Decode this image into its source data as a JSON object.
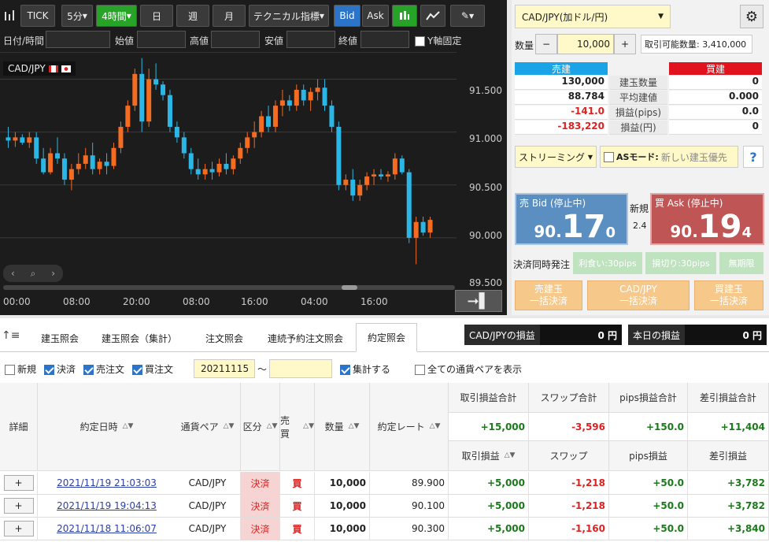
{
  "toolbar": {
    "tick": "TICK",
    "m5": "5分",
    "h4": "4時間",
    "day": "日",
    "week": "週",
    "month": "月",
    "tech": "テクニカル指標",
    "bid": "Bid",
    "ask": "Ask"
  },
  "header": {
    "date": "日付/時間",
    "open": "始値",
    "high": "高値",
    "low": "安値",
    "close": "終値",
    "yfix": "Y軸固定"
  },
  "symbol": "CAD/JPY",
  "prices": [
    "91.500",
    "91.000",
    "90.500",
    "90.000",
    "89.500"
  ],
  "times": [
    "00:00",
    "08:00",
    "20:00",
    "08:00",
    "16:00",
    "04:00",
    "16:00"
  ],
  "chart_data": {
    "type": "candlestick",
    "ylim": [
      89.5,
      91.75
    ],
    "candles": [
      [
        90.95,
        91.05,
        90.85,
        90.92
      ],
      [
        90.92,
        91.0,
        90.86,
        90.95
      ],
      [
        90.95,
        90.98,
        90.88,
        90.9
      ],
      [
        90.9,
        91.0,
        90.85,
        90.95
      ],
      [
        90.95,
        91.0,
        90.7,
        90.75
      ],
      [
        90.75,
        90.85,
        90.6,
        90.62
      ],
      [
        90.62,
        90.85,
        90.6,
        90.8
      ],
      [
        90.8,
        90.95,
        90.7,
        90.75
      ],
      [
        90.75,
        90.8,
        90.5,
        90.55
      ],
      [
        90.55,
        90.7,
        90.45,
        90.65
      ],
      [
        90.65,
        90.8,
        90.6,
        90.7
      ],
      [
        90.7,
        90.85,
        90.65,
        90.78
      ],
      [
        90.78,
        90.9,
        90.6,
        90.65
      ],
      [
        90.65,
        90.75,
        90.6,
        90.72
      ],
      [
        90.72,
        90.8,
        90.6,
        90.68
      ],
      [
        90.68,
        90.9,
        90.65,
        90.85
      ],
      [
        90.85,
        91.1,
        90.8,
        91.05
      ],
      [
        91.05,
        91.3,
        91.0,
        91.25
      ],
      [
        91.25,
        91.6,
        91.2,
        91.55
      ],
      [
        91.55,
        91.7,
        91.0,
        91.1
      ],
      [
        91.1,
        91.6,
        91.05,
        91.5
      ],
      [
        91.5,
        91.65,
        91.4,
        91.45
      ],
      [
        91.45,
        91.48,
        91.3,
        91.35
      ],
      [
        91.35,
        91.4,
        91.0,
        91.05
      ],
      [
        91.05,
        91.1,
        90.9,
        90.95
      ],
      [
        90.95,
        91.0,
        90.75,
        90.8
      ],
      [
        90.8,
        90.85,
        90.6,
        90.65
      ],
      [
        90.65,
        90.75,
        90.55,
        90.6
      ],
      [
        90.6,
        90.7,
        90.55,
        90.65
      ],
      [
        90.65,
        90.72,
        90.55,
        90.62
      ],
      [
        90.62,
        90.75,
        90.58,
        90.7
      ],
      [
        90.7,
        90.8,
        90.6,
        90.65
      ],
      [
        90.65,
        90.78,
        90.6,
        90.75
      ],
      [
        90.75,
        90.9,
        90.7,
        90.85
      ],
      [
        90.85,
        91.0,
        90.8,
        90.95
      ],
      [
        90.95,
        91.1,
        90.85,
        91.0
      ],
      [
        91.0,
        91.2,
        90.95,
        91.15
      ],
      [
        91.15,
        91.25,
        91.0,
        91.05
      ],
      [
        91.05,
        91.3,
        91.0,
        91.25
      ],
      [
        91.25,
        91.4,
        91.15,
        91.3
      ],
      [
        91.3,
        91.35,
        91.2,
        91.25
      ],
      [
        91.25,
        91.45,
        91.2,
        91.4
      ],
      [
        91.4,
        91.45,
        91.25,
        91.3
      ],
      [
        91.3,
        91.42,
        91.2,
        91.38
      ],
      [
        91.38,
        91.5,
        91.3,
        91.42
      ],
      [
        91.42,
        91.5,
        91.2,
        91.25
      ],
      [
        91.25,
        91.3,
        91.0,
        91.05
      ],
      [
        91.05,
        91.1,
        90.45,
        90.5
      ],
      [
        90.5,
        90.6,
        90.45,
        90.55
      ],
      [
        90.55,
        90.65,
        90.35,
        90.4
      ],
      [
        90.4,
        90.55,
        90.35,
        90.5
      ],
      [
        90.5,
        90.62,
        90.45,
        90.58
      ],
      [
        90.58,
        90.65,
        90.5,
        90.6
      ],
      [
        90.6,
        90.65,
        90.55,
        90.58
      ],
      [
        90.58,
        90.63,
        90.53,
        90.6
      ],
      [
        90.6,
        90.8,
        90.55,
        90.75
      ],
      [
        90.75,
        90.78,
        90.6,
        90.62
      ],
      [
        90.62,
        90.65,
        89.95,
        90.0
      ],
      [
        90.0,
        90.2,
        89.75,
        90.15
      ],
      [
        90.15,
        90.2,
        90.02,
        90.05
      ],
      [
        90.05,
        90.2,
        90.0,
        90.17
      ]
    ]
  },
  "order": {
    "pair": "CAD/JPY(加ドル/円)",
    "qty_label": "数量",
    "minus": "−",
    "qty": "10,000",
    "plus": "+",
    "avail": "取引可能数量: 3,410,000",
    "sell": "売建",
    "buy": "買建",
    "rows": [
      {
        "l": "130,000",
        "m": "建玉数量",
        "r": "0"
      },
      {
        "l": "88.784",
        "m": "平均建値",
        "r": "0.000"
      },
      {
        "l": "-141.0",
        "m": "損益(pips)",
        "r": "0.0"
      },
      {
        "l": "-183,220",
        "m": "損益(円)",
        "r": "0"
      }
    ],
    "stream": "ストリーミング",
    "asmode": "ASモード:",
    "asnew": "新しい建玉優先",
    "help": "?",
    "bid_label": "売 Bid (停止中)",
    "bid_a": "90.",
    "bid_b": "17",
    "bid_c": "0",
    "ask_label": "買 Ask (停止中)",
    "ask_a": "90.",
    "ask_b": "19",
    "ask_c": "4",
    "newlbl": "新規",
    "spread": "2.4",
    "settle": "決済同時発注",
    "tp": "利食い:30pips",
    "sl": "損切り:30pips",
    "unlim": "無期限",
    "b1a": "売建玉",
    "b1b": "一括決済",
    "b2a": "CAD/JPY",
    "b2b": "一括決済",
    "b3a": "買建玉",
    "b3b": "一括決済"
  },
  "tabs": [
    "建玉照会",
    "建玉照会（集計）",
    "注文照会",
    "連続予約注文照会",
    "約定照会"
  ],
  "pl": {
    "pair_label": "CAD/JPYの損益",
    "pair_val": "0 円",
    "today_label": "本日の損益",
    "today_val": "0 円"
  },
  "filters": {
    "new": "新規",
    "settle": "決済",
    "sell": "売注文",
    "buy": "買注文",
    "date": "20211115",
    "tilde": "〜",
    "agg": "集計する",
    "all": "全ての通貨ペアを表示"
  },
  "cols": {
    "detail": "詳細",
    "date": "約定日時",
    "pair": "通貨ペア",
    "kind": "区分",
    "side": "売買",
    "qty": "数量",
    "rate": "約定レート",
    "tpl": "取引損益合計",
    "swt": "スワップ合計",
    "pipt": "pips損益合計",
    "nett": "差引損益合計",
    "tpl2": "取引損益",
    "sw2": "スワップ",
    "pip2": "pips損益",
    "net2": "差引損益"
  },
  "totals": {
    "tpl": "+15,000",
    "sw": "-3,596",
    "pip": "+150.0",
    "net": "+11,404"
  },
  "rows": [
    {
      "plus": "+",
      "date": "2021/11/19 21:03:03",
      "pair": "CAD/JPY",
      "kind": "決済",
      "side": "買",
      "qty": "10,000",
      "rate": "89.900",
      "tpl": "+5,000",
      "sw": "-1,218",
      "pip": "+50.0",
      "net": "+3,782"
    },
    {
      "plus": "+",
      "date": "2021/11/19 19:04:13",
      "pair": "CAD/JPY",
      "kind": "決済",
      "side": "買",
      "qty": "10,000",
      "rate": "90.100",
      "tpl": "+5,000",
      "sw": "-1,218",
      "pip": "+50.0",
      "net": "+3,782"
    },
    {
      "plus": "+",
      "date": "2021/11/18 11:06:07",
      "pair": "CAD/JPY",
      "kind": "決済",
      "side": "買",
      "qty": "10,000",
      "rate": "90.300",
      "tpl": "+5,000",
      "sw": "-1,160",
      "pip": "+50.0",
      "net": "+3,840"
    }
  ]
}
